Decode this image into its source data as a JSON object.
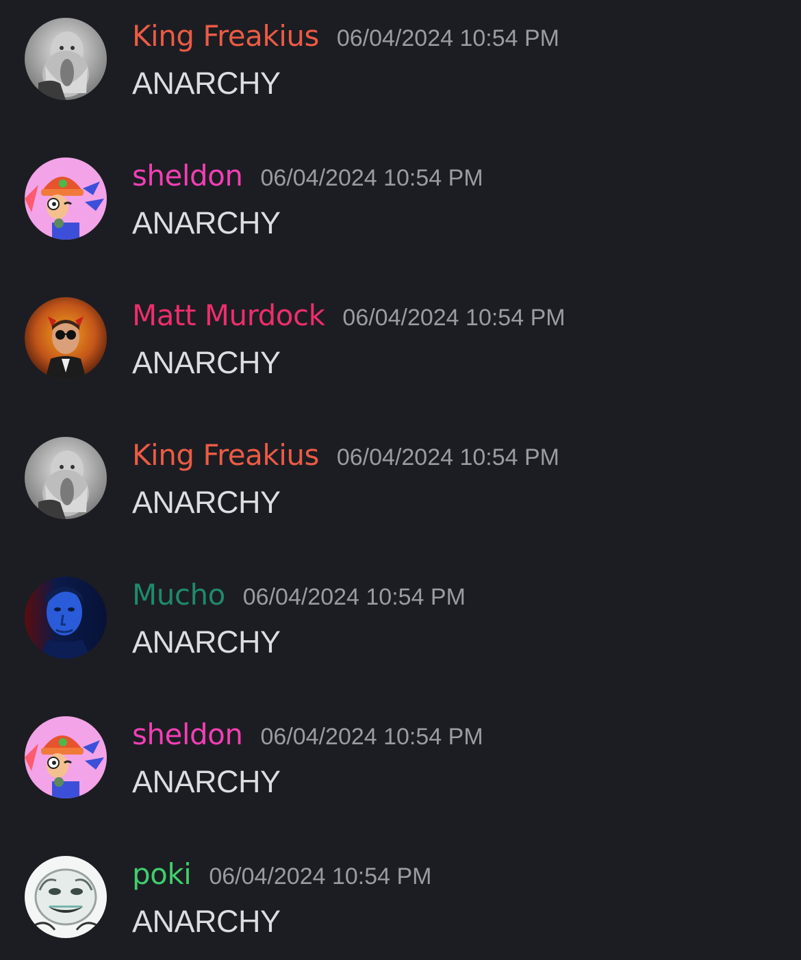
{
  "colors": {
    "background": "#1c1d22",
    "timestamp": "#9b9ca3",
    "message_text": "#dcdde1"
  },
  "messages": [
    {
      "username": "King Freakius",
      "color": "#ec5b45",
      "timestamp": "06/04/2024 10:54 PM",
      "content": "ANARCHY",
      "avatar": "darwin-portrait"
    },
    {
      "username": "sheldon",
      "color": "#f23fb4",
      "timestamp": "06/04/2024 10:54 PM",
      "content": "ANARCHY",
      "avatar": "cartoon-dog-rapper"
    },
    {
      "username": "Matt Murdock",
      "color": "#ee2e6b",
      "timestamp": "06/04/2024 10:54 PM",
      "content": "ANARCHY",
      "avatar": "daredevil-portrait"
    },
    {
      "username": "King Freakius",
      "color": "#ec5b45",
      "timestamp": "06/04/2024 10:54 PM",
      "content": "ANARCHY",
      "avatar": "darwin-portrait"
    },
    {
      "username": "Mucho",
      "color": "#1f8a6b",
      "timestamp": "06/04/2024 10:54 PM",
      "content": "ANARCHY",
      "avatar": "blue-lit-portrait"
    },
    {
      "username": "sheldon",
      "color": "#f23fb4",
      "timestamp": "06/04/2024 10:54 PM",
      "content": "ANARCHY",
      "avatar": "cartoon-dog-rapper"
    },
    {
      "username": "poki",
      "color": "#3fcf6c",
      "timestamp": "06/04/2024 10:54 PM",
      "content": "ANARCHY",
      "avatar": "meme-face"
    }
  ]
}
